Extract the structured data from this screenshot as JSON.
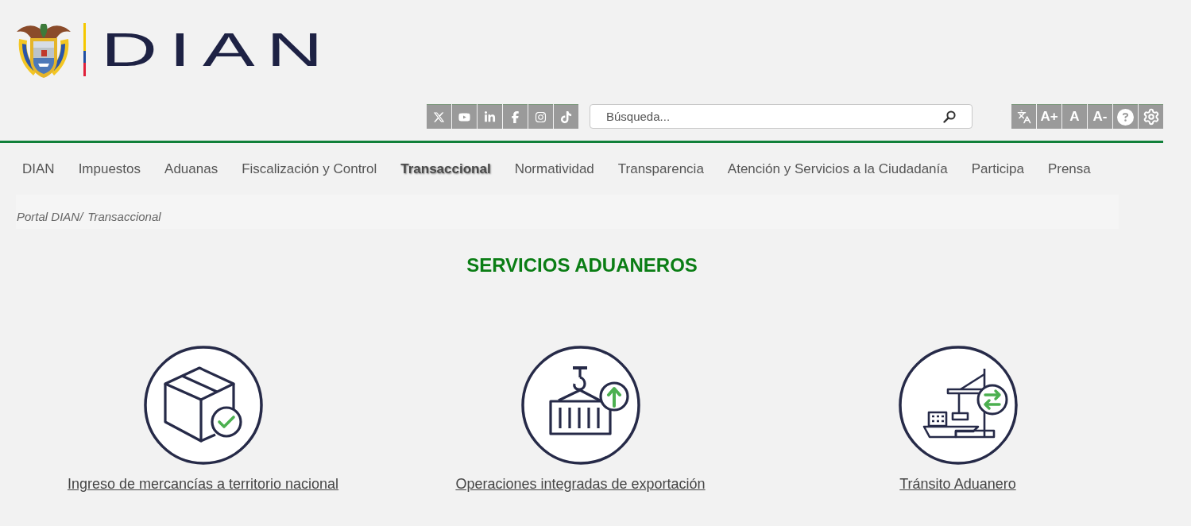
{
  "logo": {
    "text": "DIAN"
  },
  "search": {
    "placeholder": "Búsqueda..."
  },
  "text_size_buttons": [
    "A+",
    "A",
    "A-"
  ],
  "nav": [
    {
      "label": "DIAN",
      "selected": false
    },
    {
      "label": "Impuestos",
      "selected": false
    },
    {
      "label": "Aduanas",
      "selected": false
    },
    {
      "label": "Fiscalización y Control",
      "selected": false
    },
    {
      "label": "Transaccional",
      "selected": true
    },
    {
      "label": "Normatividad",
      "selected": false
    },
    {
      "label": "Transparencia",
      "selected": false
    },
    {
      "label": "Atención y Servicios a la Ciudadanía",
      "selected": false
    },
    {
      "label": "Participa",
      "selected": false
    },
    {
      "label": "Prensa",
      "selected": false
    }
  ],
  "breadcrumb": [
    "Portal DIAN/",
    "Transaccional"
  ],
  "title": "SERVICIOS ADUANEROS",
  "services": [
    {
      "kind": "box",
      "label": "Ingreso de mercancías a territorio nacional"
    },
    {
      "kind": "container",
      "label": "Operaciones integradas de exportación"
    },
    {
      "kind": "ship",
      "label": "Tránsito Aduanero"
    }
  ]
}
